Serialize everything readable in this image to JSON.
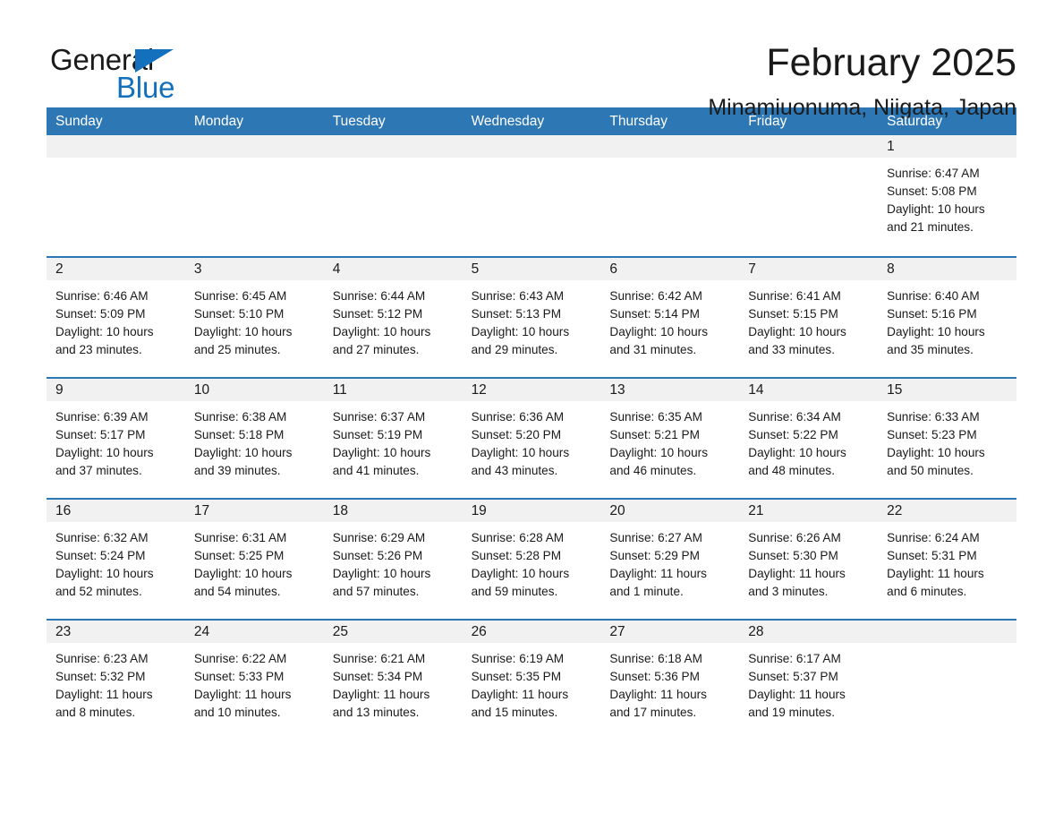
{
  "brand": {
    "name_part1": "General",
    "name_part2": "Blue",
    "accent_color": "#1270bd",
    "triangle_icon": "triangle-icon"
  },
  "header": {
    "title": "February 2025",
    "subtitle": "Minamiuonuma, Niigata, Japan"
  },
  "colors": {
    "header_blue": "#2e77b5",
    "date_band_gray": "#f1f1f1",
    "text": "#1a1a1a"
  },
  "weekdays": [
    "Sunday",
    "Monday",
    "Tuesday",
    "Wednesday",
    "Thursday",
    "Friday",
    "Saturday"
  ],
  "weeks": [
    [
      {
        "day": "",
        "sunrise": "",
        "sunset": "",
        "daylight1": "",
        "daylight2": ""
      },
      {
        "day": "",
        "sunrise": "",
        "sunset": "",
        "daylight1": "",
        "daylight2": ""
      },
      {
        "day": "",
        "sunrise": "",
        "sunset": "",
        "daylight1": "",
        "daylight2": ""
      },
      {
        "day": "",
        "sunrise": "",
        "sunset": "",
        "daylight1": "",
        "daylight2": ""
      },
      {
        "day": "",
        "sunrise": "",
        "sunset": "",
        "daylight1": "",
        "daylight2": ""
      },
      {
        "day": "",
        "sunrise": "",
        "sunset": "",
        "daylight1": "",
        "daylight2": ""
      },
      {
        "day": "1",
        "sunrise": "Sunrise: 6:47 AM",
        "sunset": "Sunset: 5:08 PM",
        "daylight1": "Daylight: 10 hours",
        "daylight2": "and 21 minutes."
      }
    ],
    [
      {
        "day": "2",
        "sunrise": "Sunrise: 6:46 AM",
        "sunset": "Sunset: 5:09 PM",
        "daylight1": "Daylight: 10 hours",
        "daylight2": "and 23 minutes."
      },
      {
        "day": "3",
        "sunrise": "Sunrise: 6:45 AM",
        "sunset": "Sunset: 5:10 PM",
        "daylight1": "Daylight: 10 hours",
        "daylight2": "and 25 minutes."
      },
      {
        "day": "4",
        "sunrise": "Sunrise: 6:44 AM",
        "sunset": "Sunset: 5:12 PM",
        "daylight1": "Daylight: 10 hours",
        "daylight2": "and 27 minutes."
      },
      {
        "day": "5",
        "sunrise": "Sunrise: 6:43 AM",
        "sunset": "Sunset: 5:13 PM",
        "daylight1": "Daylight: 10 hours",
        "daylight2": "and 29 minutes."
      },
      {
        "day": "6",
        "sunrise": "Sunrise: 6:42 AM",
        "sunset": "Sunset: 5:14 PM",
        "daylight1": "Daylight: 10 hours",
        "daylight2": "and 31 minutes."
      },
      {
        "day": "7",
        "sunrise": "Sunrise: 6:41 AM",
        "sunset": "Sunset: 5:15 PM",
        "daylight1": "Daylight: 10 hours",
        "daylight2": "and 33 minutes."
      },
      {
        "day": "8",
        "sunrise": "Sunrise: 6:40 AM",
        "sunset": "Sunset: 5:16 PM",
        "daylight1": "Daylight: 10 hours",
        "daylight2": "and 35 minutes."
      }
    ],
    [
      {
        "day": "9",
        "sunrise": "Sunrise: 6:39 AM",
        "sunset": "Sunset: 5:17 PM",
        "daylight1": "Daylight: 10 hours",
        "daylight2": "and 37 minutes."
      },
      {
        "day": "10",
        "sunrise": "Sunrise: 6:38 AM",
        "sunset": "Sunset: 5:18 PM",
        "daylight1": "Daylight: 10 hours",
        "daylight2": "and 39 minutes."
      },
      {
        "day": "11",
        "sunrise": "Sunrise: 6:37 AM",
        "sunset": "Sunset: 5:19 PM",
        "daylight1": "Daylight: 10 hours",
        "daylight2": "and 41 minutes."
      },
      {
        "day": "12",
        "sunrise": "Sunrise: 6:36 AM",
        "sunset": "Sunset: 5:20 PM",
        "daylight1": "Daylight: 10 hours",
        "daylight2": "and 43 minutes."
      },
      {
        "day": "13",
        "sunrise": "Sunrise: 6:35 AM",
        "sunset": "Sunset: 5:21 PM",
        "daylight1": "Daylight: 10 hours",
        "daylight2": "and 46 minutes."
      },
      {
        "day": "14",
        "sunrise": "Sunrise: 6:34 AM",
        "sunset": "Sunset: 5:22 PM",
        "daylight1": "Daylight: 10 hours",
        "daylight2": "and 48 minutes."
      },
      {
        "day": "15",
        "sunrise": "Sunrise: 6:33 AM",
        "sunset": "Sunset: 5:23 PM",
        "daylight1": "Daylight: 10 hours",
        "daylight2": "and 50 minutes."
      }
    ],
    [
      {
        "day": "16",
        "sunrise": "Sunrise: 6:32 AM",
        "sunset": "Sunset: 5:24 PM",
        "daylight1": "Daylight: 10 hours",
        "daylight2": "and 52 minutes."
      },
      {
        "day": "17",
        "sunrise": "Sunrise: 6:31 AM",
        "sunset": "Sunset: 5:25 PM",
        "daylight1": "Daylight: 10 hours",
        "daylight2": "and 54 minutes."
      },
      {
        "day": "18",
        "sunrise": "Sunrise: 6:29 AM",
        "sunset": "Sunset: 5:26 PM",
        "daylight1": "Daylight: 10 hours",
        "daylight2": "and 57 minutes."
      },
      {
        "day": "19",
        "sunrise": "Sunrise: 6:28 AM",
        "sunset": "Sunset: 5:28 PM",
        "daylight1": "Daylight: 10 hours",
        "daylight2": "and 59 minutes."
      },
      {
        "day": "20",
        "sunrise": "Sunrise: 6:27 AM",
        "sunset": "Sunset: 5:29 PM",
        "daylight1": "Daylight: 11 hours",
        "daylight2": "and 1 minute."
      },
      {
        "day": "21",
        "sunrise": "Sunrise: 6:26 AM",
        "sunset": "Sunset: 5:30 PM",
        "daylight1": "Daylight: 11 hours",
        "daylight2": "and 3 minutes."
      },
      {
        "day": "22",
        "sunrise": "Sunrise: 6:24 AM",
        "sunset": "Sunset: 5:31 PM",
        "daylight1": "Daylight: 11 hours",
        "daylight2": "and 6 minutes."
      }
    ],
    [
      {
        "day": "23",
        "sunrise": "Sunrise: 6:23 AM",
        "sunset": "Sunset: 5:32 PM",
        "daylight1": "Daylight: 11 hours",
        "daylight2": "and 8 minutes."
      },
      {
        "day": "24",
        "sunrise": "Sunrise: 6:22 AM",
        "sunset": "Sunset: 5:33 PM",
        "daylight1": "Daylight: 11 hours",
        "daylight2": "and 10 minutes."
      },
      {
        "day": "25",
        "sunrise": "Sunrise: 6:21 AM",
        "sunset": "Sunset: 5:34 PM",
        "daylight1": "Daylight: 11 hours",
        "daylight2": "and 13 minutes."
      },
      {
        "day": "26",
        "sunrise": "Sunrise: 6:19 AM",
        "sunset": "Sunset: 5:35 PM",
        "daylight1": "Daylight: 11 hours",
        "daylight2": "and 15 minutes."
      },
      {
        "day": "27",
        "sunrise": "Sunrise: 6:18 AM",
        "sunset": "Sunset: 5:36 PM",
        "daylight1": "Daylight: 11 hours",
        "daylight2": "and 17 minutes."
      },
      {
        "day": "28",
        "sunrise": "Sunrise: 6:17 AM",
        "sunset": "Sunset: 5:37 PM",
        "daylight1": "Daylight: 11 hours",
        "daylight2": "and 19 minutes."
      },
      {
        "day": "",
        "sunrise": "",
        "sunset": "",
        "daylight1": "",
        "daylight2": ""
      }
    ]
  ]
}
